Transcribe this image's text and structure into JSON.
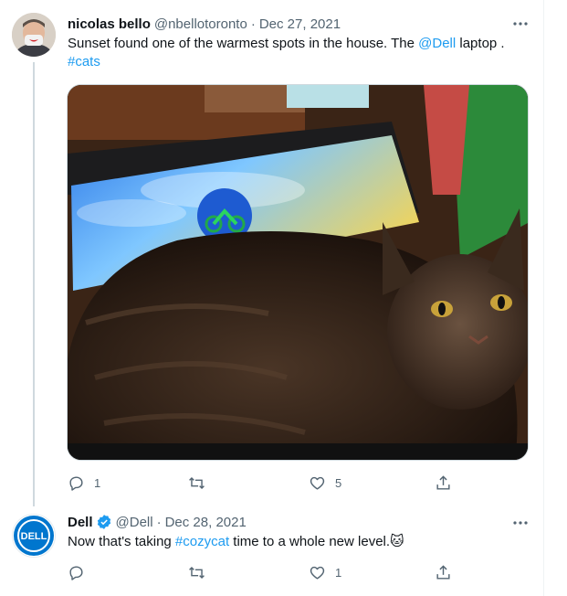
{
  "tweets": [
    {
      "author_name": "nicolas bello",
      "handle": "@nbellotoronto",
      "separator": "·",
      "date": "Dec 27, 2021",
      "text_before": "Sunset found one of the warmest spots in the house.  The ",
      "mention": "@Dell",
      "text_after": " laptop .",
      "hashtag": "#cats",
      "replies": "1",
      "retweets": "",
      "likes": "5"
    },
    {
      "author_name": "Dell",
      "handle": "@Dell",
      "separator": "·",
      "date": "Dec 28, 2021",
      "text_before": "Now that's taking ",
      "hashtag": "#cozycat",
      "text_after": " time to a whole new level.",
      "emoji": "🐱",
      "replies": "",
      "retweets": "",
      "likes": "1",
      "avatar_logo": "DELL"
    }
  ],
  "icons": {
    "more": "more-icon",
    "reply": "reply-icon",
    "retweet": "retweet-icon",
    "like": "like-icon",
    "share": "share-icon",
    "verified": "verified-badge-icon"
  },
  "colors": {
    "accent": "#1d9bf0",
    "muted": "#536471",
    "dell_blue": "#0076ce"
  }
}
